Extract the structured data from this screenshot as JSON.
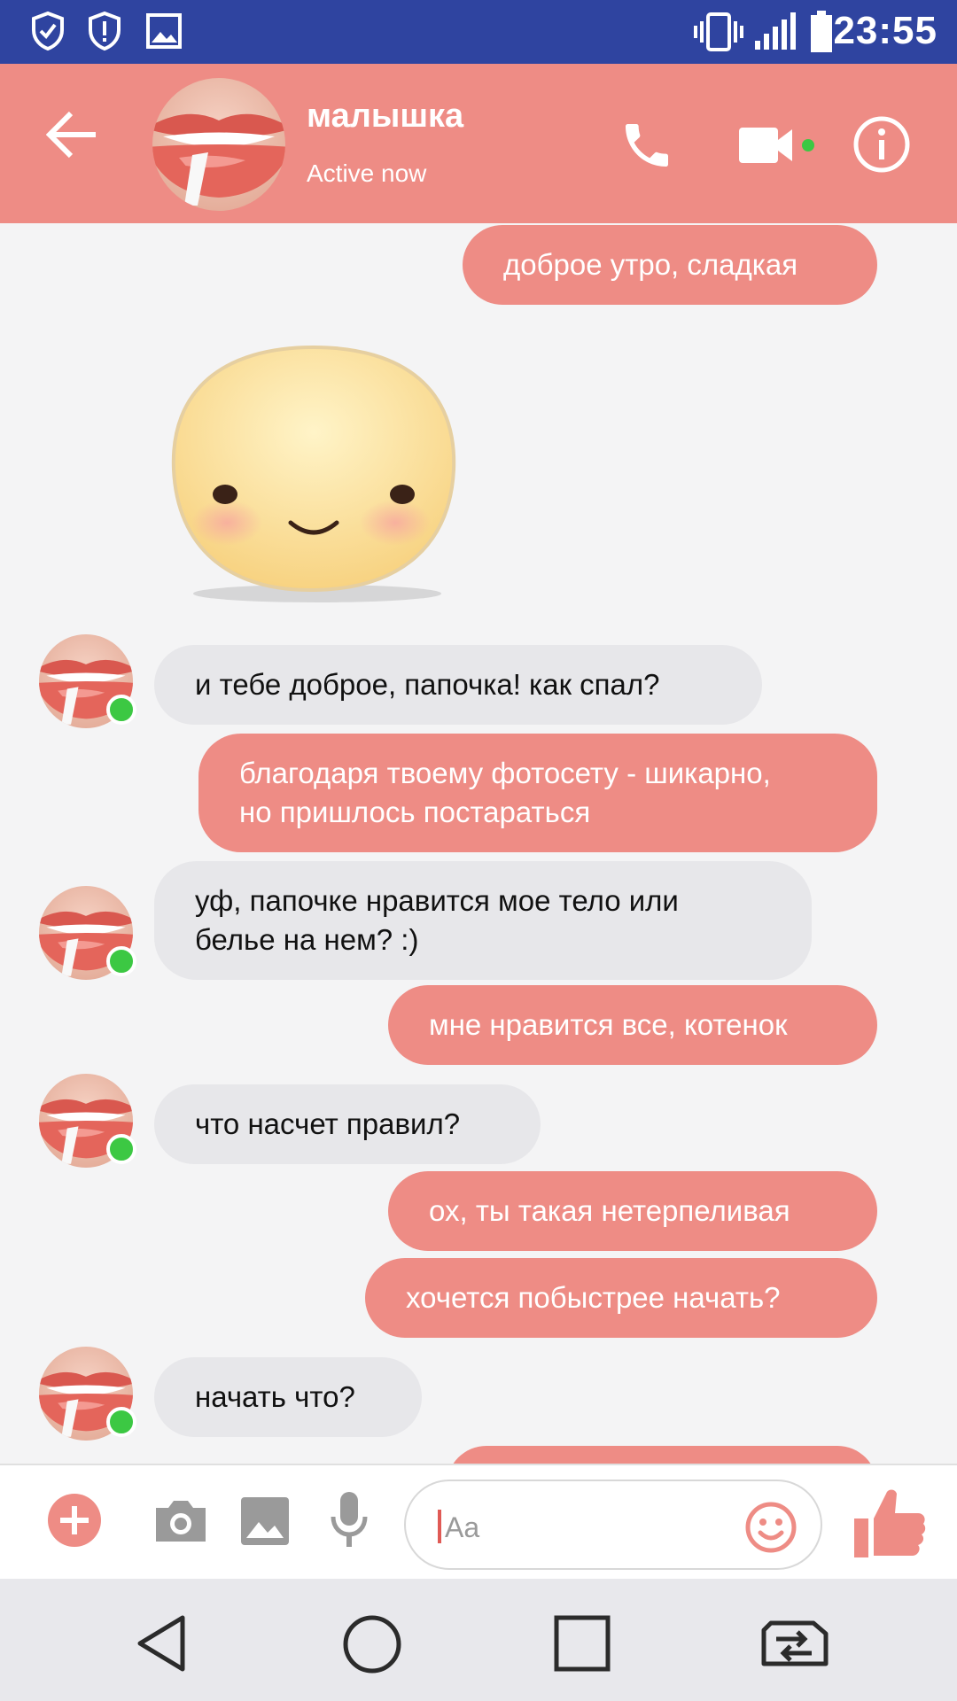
{
  "status_bar": {
    "time": "23:55",
    "icons": [
      "shield-check-icon",
      "shield-alert-icon",
      "image-icon",
      "vibrate-icon",
      "signal-icon",
      "battery-icon"
    ]
  },
  "header": {
    "contact_name": "малышка",
    "status": "Active now",
    "icons": [
      "back-arrow-icon",
      "phone-icon",
      "video-camera-icon",
      "info-icon"
    ]
  },
  "messages": [
    {
      "from": "me",
      "text": "доброе утро, сладкая"
    },
    {
      "from": "them",
      "type": "sticker",
      "sticker": "smiling-face-sticker"
    },
    {
      "from": "them",
      "text": "и тебе доброе, папочка! как спал?"
    },
    {
      "from": "me",
      "text": "благодаря твоему фотосету - шикарно,\nно пришлось постараться"
    },
    {
      "from": "them",
      "text": "уф, папочке нравится мое тело или\nбелье на нем? :)"
    },
    {
      "from": "me",
      "text": "мне нравится все, котенок"
    },
    {
      "from": "them",
      "text": "что насчет правил?"
    },
    {
      "from": "me",
      "text": "ох, ты такая нетерпеливая"
    },
    {
      "from": "me",
      "text": "хочется побыстрее начать?"
    },
    {
      "from": "them",
      "text": "начать что?"
    }
  ],
  "composer": {
    "placeholder": "Aa",
    "icons": [
      "plus-icon",
      "camera-icon",
      "gallery-icon",
      "microphone-icon",
      "emoji-icon",
      "thumbs-up-icon"
    ]
  },
  "nav_bar": {
    "icons": [
      "back-triangle-icon",
      "home-circle-icon",
      "recents-square-icon",
      "switch-sim-icon"
    ]
  },
  "colors": {
    "accent": "#ee8c85",
    "status_bar": "#2f44a0",
    "incoming_bubble": "#e7e7ea",
    "online": "#3cc843"
  }
}
